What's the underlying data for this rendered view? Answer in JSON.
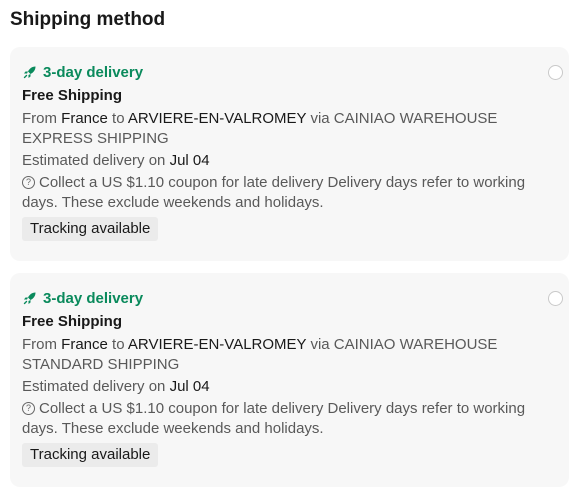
{
  "heading": "Shipping method",
  "options": [
    {
      "badge": "3-day delivery",
      "title": "Free Shipping",
      "route_prefix": "From",
      "origin": "France",
      "route_to": "to",
      "destination": "ARVIERE-EN-VALROMEY",
      "route_via": "via CAINIAO WAREHOUSE EXPRESS SHIPPING",
      "estimate_label": "Estimated delivery on",
      "estimate_date": "Jul 04",
      "coupon_text": "Collect a US $1.10 coupon for late delivery Delivery days refer to working days. These exclude weekends and holidays.",
      "tag": "Tracking available",
      "selected": false
    },
    {
      "badge": "3-day delivery",
      "title": "Free Shipping",
      "route_prefix": "From",
      "origin": "France",
      "route_to": "to",
      "destination": "ARVIERE-EN-VALROMEY",
      "route_via": "via CAINIAO WAREHOUSE STANDARD SHIPPING",
      "estimate_label": "Estimated delivery on",
      "estimate_date": "Jul 04",
      "coupon_text": "Collect a US $1.10 coupon for late delivery Delivery days refer to working days. These exclude weekends and holidays.",
      "tag": "Tracking available",
      "selected": false
    }
  ],
  "colors": {
    "accent": "#0a8a5c",
    "card_bg": "#f7f7f7",
    "tag_bg": "#ebebeb"
  },
  "icons": {
    "badge": "rocket-icon",
    "help": "help-circle-icon"
  }
}
